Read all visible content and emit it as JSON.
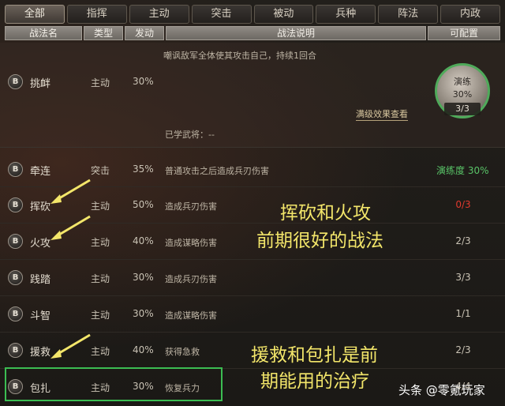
{
  "tabs": [
    "全部",
    "指挥",
    "主动",
    "突击",
    "被动",
    "兵种",
    "阵法",
    "内政"
  ],
  "headers": {
    "name": "战法名",
    "type": "类型",
    "rate": "发动",
    "desc": "战法说明",
    "config": "可配置"
  },
  "selected": {
    "badge": "B",
    "name": "挑衅",
    "type": "主动",
    "rate": "30%",
    "desc": "嘲讽敌军全体使其攻击自己，持续1回合",
    "learned_label": "已学武将：--",
    "max_effect_link": "满级效果查看",
    "train_label": "演练",
    "train_pct": "30%",
    "train_count": "3/3"
  },
  "rows": [
    {
      "badge": "B",
      "name": "牵连",
      "type": "突击",
      "rate": "35%",
      "desc": "普通攻击之后造成兵刃伤害",
      "config": "演练度 30%"
    },
    {
      "badge": "B",
      "name": "挥砍",
      "type": "主动",
      "rate": "50%",
      "desc": "造成兵刃伤害",
      "config": "0/3"
    },
    {
      "badge": "B",
      "name": "火攻",
      "type": "主动",
      "rate": "40%",
      "desc": "造成谋略伤害",
      "config": "2/3"
    },
    {
      "badge": "B",
      "name": "践踏",
      "type": "主动",
      "rate": "30%",
      "desc": "造成兵刃伤害",
      "config": "3/3"
    },
    {
      "badge": "B",
      "name": "斗智",
      "type": "主动",
      "rate": "30%",
      "desc": "造成谋略伤害",
      "config": "1/1"
    },
    {
      "badge": "B",
      "name": "援救",
      "type": "主动",
      "rate": "40%",
      "desc": "获得急救",
      "config": "2/3"
    },
    {
      "badge": "B",
      "name": "包扎",
      "type": "主动",
      "rate": "30%",
      "desc": "恢复兵力",
      "config": "4/4"
    }
  ],
  "annotations": {
    "a1_line1": "挥砍和火攻",
    "a1_line2": "前期很好的战法",
    "a2_line1": "援救和包扎是前",
    "a2_line2": "期能用的治疗"
  },
  "watermark": "头条 @零氪玩家",
  "colors": {
    "green": "#59c468",
    "red": "#e03a2e",
    "annotation": "#f3e66a",
    "highlight_box": "#3bbd52"
  }
}
